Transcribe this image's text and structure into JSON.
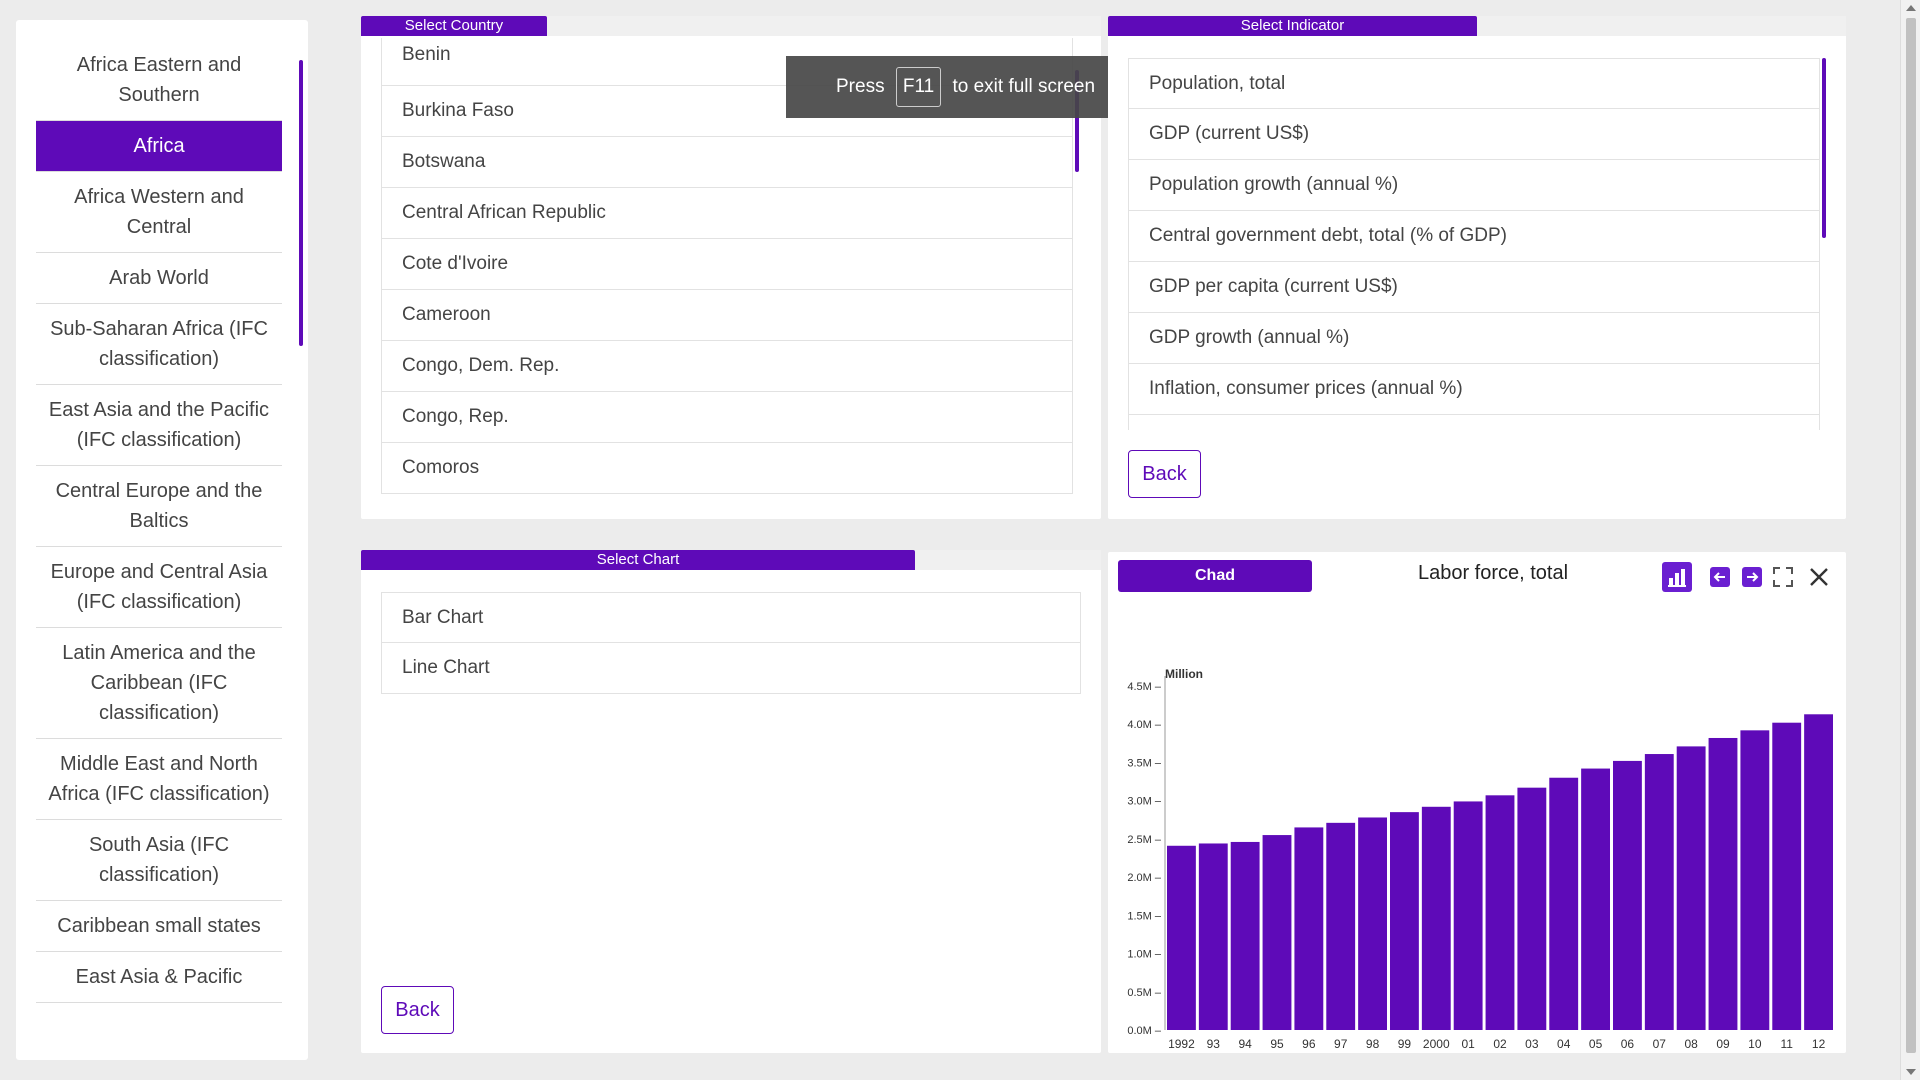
{
  "regions": {
    "items": [
      {
        "label": "Africa Eastern and Southern",
        "active": false
      },
      {
        "label": "Africa",
        "active": true
      },
      {
        "label": "Africa Western and Central",
        "active": false
      },
      {
        "label": "Arab World",
        "active": false
      },
      {
        "label": "Sub-Saharan Africa (IFC classification)",
        "active": false
      },
      {
        "label": "East Asia and the Pacific (IFC classification)",
        "active": false
      },
      {
        "label": "Central Europe and the Baltics",
        "active": false
      },
      {
        "label": "Europe and Central Asia (IFC classification)",
        "active": false
      },
      {
        "label": "Latin America and the Caribbean (IFC classification)",
        "active": false
      },
      {
        "label": "Middle East and North Africa (IFC classification)",
        "active": false
      },
      {
        "label": "South Asia (IFC classification)",
        "active": false
      },
      {
        "label": "Caribbean small states",
        "active": false
      },
      {
        "label": "East Asia & Pacific",
        "active": false
      }
    ]
  },
  "country_panel": {
    "tab_label": "Select Country",
    "items": [
      "Benin",
      "Burkina Faso",
      "Botswana",
      "Central African Republic",
      "Cote d'Ivoire",
      "Cameroon",
      "Congo, Dem. Rep.",
      "Congo, Rep.",
      "Comoros"
    ]
  },
  "toast": {
    "press": "Press",
    "key": "F11",
    "rest": "to exit full screen"
  },
  "indicator_panel": {
    "tab_label": "Select Indicator",
    "items": [
      "Population, total",
      "GDP (current US$)",
      "Population growth (annual %)",
      "Central government debt, total (% of GDP)",
      "GDP per capita (current US$)",
      "GDP growth (annual %)",
      "Inflation, consumer prices (annual %)"
    ],
    "back_label": "Back"
  },
  "chart_panel": {
    "tab_label": "Select Chart",
    "items": [
      "Bar Chart",
      "Line Chart"
    ],
    "back_label": "Back"
  },
  "chart_card": {
    "country": "Chad",
    "title": "Labor force, total"
  },
  "colors": {
    "accent": "#5e0ab8",
    "bar": "#5e0ab8"
  },
  "chart_data": {
    "type": "bar",
    "title": "Labor force, total",
    "unit_label": "Million",
    "categories": [
      "1992",
      "93",
      "94",
      "95",
      "96",
      "97",
      "98",
      "99",
      "2000",
      "01",
      "02",
      "03",
      "04",
      "05",
      "06",
      "07",
      "08",
      "09",
      "10",
      "11",
      "12"
    ],
    "values": [
      2.41,
      2.44,
      2.46,
      2.55,
      2.65,
      2.71,
      2.78,
      2.85,
      2.92,
      2.99,
      3.07,
      3.17,
      3.3,
      3.42,
      3.52,
      3.61,
      3.71,
      3.82,
      3.92,
      4.02,
      4.13
    ],
    "yticks": [
      "0.0M",
      "0.5M",
      "1.0M",
      "1.5M",
      "2.0M",
      "2.5M",
      "3.0M",
      "3.5M",
      "4.0M",
      "4.5M"
    ],
    "ylim": [
      0,
      4.5
    ]
  }
}
